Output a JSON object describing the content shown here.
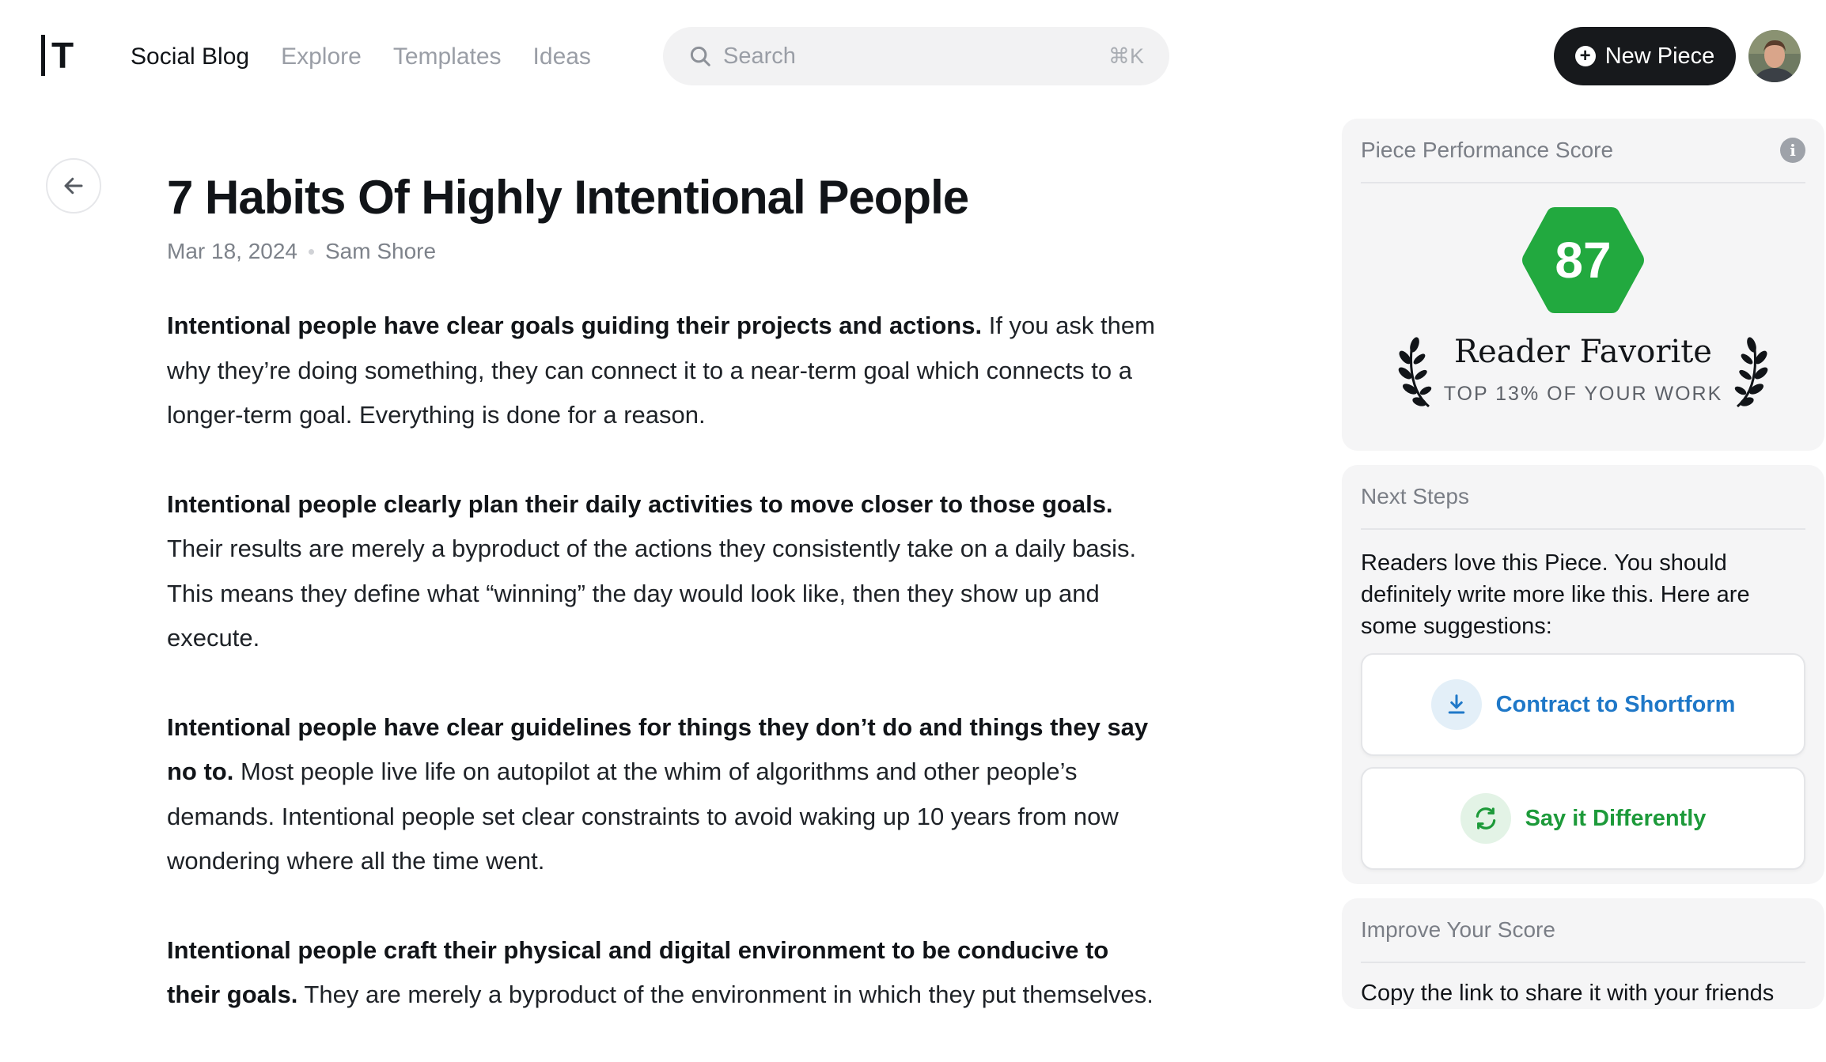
{
  "logo": {
    "letter": "T"
  },
  "nav": {
    "items": [
      {
        "label": "Social Blog",
        "active": true
      },
      {
        "label": "Explore",
        "active": false
      },
      {
        "label": "Templates",
        "active": false
      },
      {
        "label": "Ideas",
        "active": false
      }
    ]
  },
  "search": {
    "placeholder": "Search",
    "shortcut": "⌘K"
  },
  "header": {
    "new_piece_label": "New Piece"
  },
  "article": {
    "title": "7 Habits Of Highly Intentional People",
    "date": "Mar 18, 2024",
    "author": "Sam Shore",
    "paragraphs": [
      {
        "bold": "Intentional people have clear goals guiding their projects and actions.",
        "text": " If you ask them why they’re doing something, they can connect it to a near-term goal which connects to a longer-term goal. Everything is done for a reason."
      },
      {
        "bold": "Intentional people clearly plan their daily activities to move closer to those goals.",
        "text": " Their results are merely a byproduct of the actions they consistently take on a daily basis. This means they define what “winning” the day would look like, then they show up and execute."
      },
      {
        "bold": "Intentional people have clear guidelines for things they don’t do and things they say no to.",
        "text": " Most people live life on autopilot at the whim of algorithms and other people’s demands. Intentional people set clear constraints to avoid waking up 10 years from now wondering where all the time went."
      },
      {
        "bold": "Intentional people craft their physical and digital environment to be conducive to their goals.",
        "text": " They are merely a byproduct of the environment in which they put themselves."
      }
    ]
  },
  "performance": {
    "heading": "Piece Performance Score",
    "score": "87",
    "award_title": "Reader Favorite",
    "award_subtitle": "TOP 13% OF YOUR WORK",
    "score_color": "#22a93f"
  },
  "next_steps": {
    "heading": "Next Steps",
    "text": "Readers love this Piece. You should definitely write more like this. Here are some suggestions:",
    "actions": [
      {
        "label": "Contract to Shortform",
        "icon": "download-icon",
        "color": "#1f78c8"
      },
      {
        "label": "Say it Differently",
        "icon": "refresh-icon",
        "color": "#1d9a3a"
      }
    ]
  },
  "improve": {
    "heading": "Improve Your Score",
    "text": "Copy the link to share it with your friends"
  }
}
